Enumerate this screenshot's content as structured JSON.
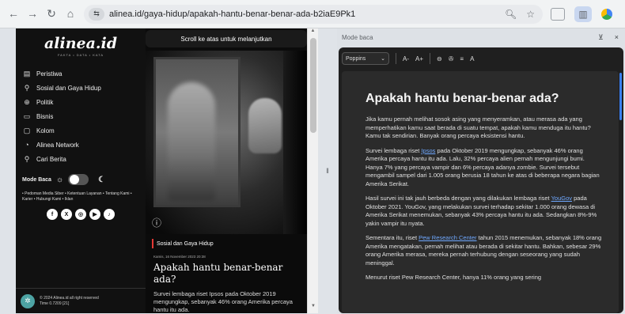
{
  "browser": {
    "url": "alinea.id/gaya-hidup/apakah-hantu-benar-benar-ada-b2iaE9Pk1",
    "nav_icons": [
      "back-icon",
      "forward-icon",
      "reload-icon",
      "home-icon"
    ],
    "site_chip": "⇆"
  },
  "sidebar": {
    "logo": "alinea.id",
    "logo_sub": "FAKTA • DATA • KATA",
    "items": [
      {
        "icon": "▤",
        "label": "Peristiwa"
      },
      {
        "icon": "⚲",
        "label": "Sosial dan Gaya Hidup"
      },
      {
        "icon": "⊕",
        "label": "Politik"
      },
      {
        "icon": "▭",
        "label": "Bisnis"
      },
      {
        "icon": "▢",
        "label": "Kolom"
      },
      {
        "icon": "◔",
        "label": "Alinea Network"
      },
      {
        "icon": "⚲",
        "label": "Cari Berita"
      }
    ],
    "mode_label": "Mode Baca",
    "links": "• Pedoman Media Siber • Ketentuan Layanan • Tentang Kami • Karier • Hubungi Kami • Iklan",
    "social": [
      "f",
      "X",
      "◎",
      "▶",
      "♪"
    ],
    "footer_line1": "© 2024 Alinea.id all right reserved",
    "footer_line2": "Time 0.7209 [21]"
  },
  "center": {
    "scroll_hint": "Scroll ke atas untuk melanjutkan",
    "category": "Sosial dan Gaya Hidup",
    "date": "Kamis, 16 November 2023 20:38",
    "headline": "Apakah hantu benar-benar ada?",
    "lede": "Survei lembaga riset Ipsos pada Oktober 2019 mengungkap, sebanyak 46% orang Amerika percaya hantu itu ada."
  },
  "reader": {
    "label": "Mode baca",
    "pin_icon": "pin-icon",
    "close_icon": "close-icon",
    "font": "Poppins",
    "tools": [
      "A-",
      "A+",
      "⊖",
      "✇",
      "≡",
      "A"
    ],
    "title": "Apakah hantu benar-benar ada?",
    "p1": "Jika kamu pernah melihat sosok asing yang menyeramkan, atau merasa ada yang memperhatikan kamu saat berada di suatu tempat, apakah kamu menduga itu hantu? Kamu tak sendirian. Banyak orang percaya eksistensi hantu.",
    "p2_pre": "Survei lembaga riset ",
    "p2_link": "Ipsos",
    "p2_post": " pada Oktober 2019 mengungkap, sebanyak 46% orang Amerika percaya hantu itu ada. Lalu, 32% percaya alien pernah mengunjungi bumi. Hanya 7% yang percaya vampir dan 6% percaya adanya zombie. Survei tersebut mengambil sampel dari 1.005 orang berusia 18 tahun ke atas di beberapa negara bagian Amerika Serikat.",
    "p3_pre": "Hasil survei ini tak jauh berbeda dengan yang dilakukan lembaga riset ",
    "p3_link": "YouGov",
    "p3_post": " pada Oktober 2021. YouGov, yang melakukan survei terhadap sekitar 1.000 orang dewasa di Amerika Serikat menemukan, sebanyak 43% percaya hantu itu ada. Sedangkan 8%-9% yakin vampir itu nyata.",
    "p4_pre": "Sementara itu, riset ",
    "p4_link": "Pew Research Center",
    "p4_post": " tahun 2015 menemukan, sebanyak 18% orang Amerika mengatakan, pernah melihat atau berada di sekitar hantu. Bahkan, sebesar 29% orang Amerika merasa, mereka pernah terhubung dengan seseorang yang sudah meninggal.",
    "p5": "Menurut riset Pew Research Center, hanya 11% orang yang sering"
  }
}
